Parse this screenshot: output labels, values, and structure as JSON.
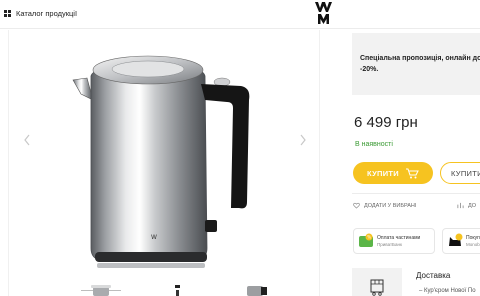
{
  "header": {
    "catalog_label": "Каталог продукції",
    "catalog_icon": "grid-icon",
    "logo_icon": "wmf-logo-icon"
  },
  "gallery": {
    "prev_icon": "chevron-left-icon",
    "next_icon": "chevron-right-icon",
    "main_image": "electric-kettle-image",
    "thumbnails_count": 3
  },
  "product": {
    "offer_text": "Спеціальна пропозиція, онлайн до\n-20%.",
    "price": "6 499 грн",
    "stock": "В наявності",
    "buy_label": "КУПИТИ",
    "credit_label": "КУПИТИ",
    "wishlist_label": "ДОДАТИ У ВИБРАНІ",
    "compare_label": "ДО",
    "payment_1": {
      "title": "Оплата частинами",
      "subtitle": "ПриватБанк"
    },
    "payment_2": {
      "title": "Покуп",
      "subtitle": "Monob"
    },
    "delivery_title": "Доставка",
    "delivery_item": "–  Кур'єром Нової По"
  },
  "colors": {
    "accent": "#f6c320",
    "in_stock": "#3a9a33",
    "panel_bg": "#f2f2f2"
  }
}
